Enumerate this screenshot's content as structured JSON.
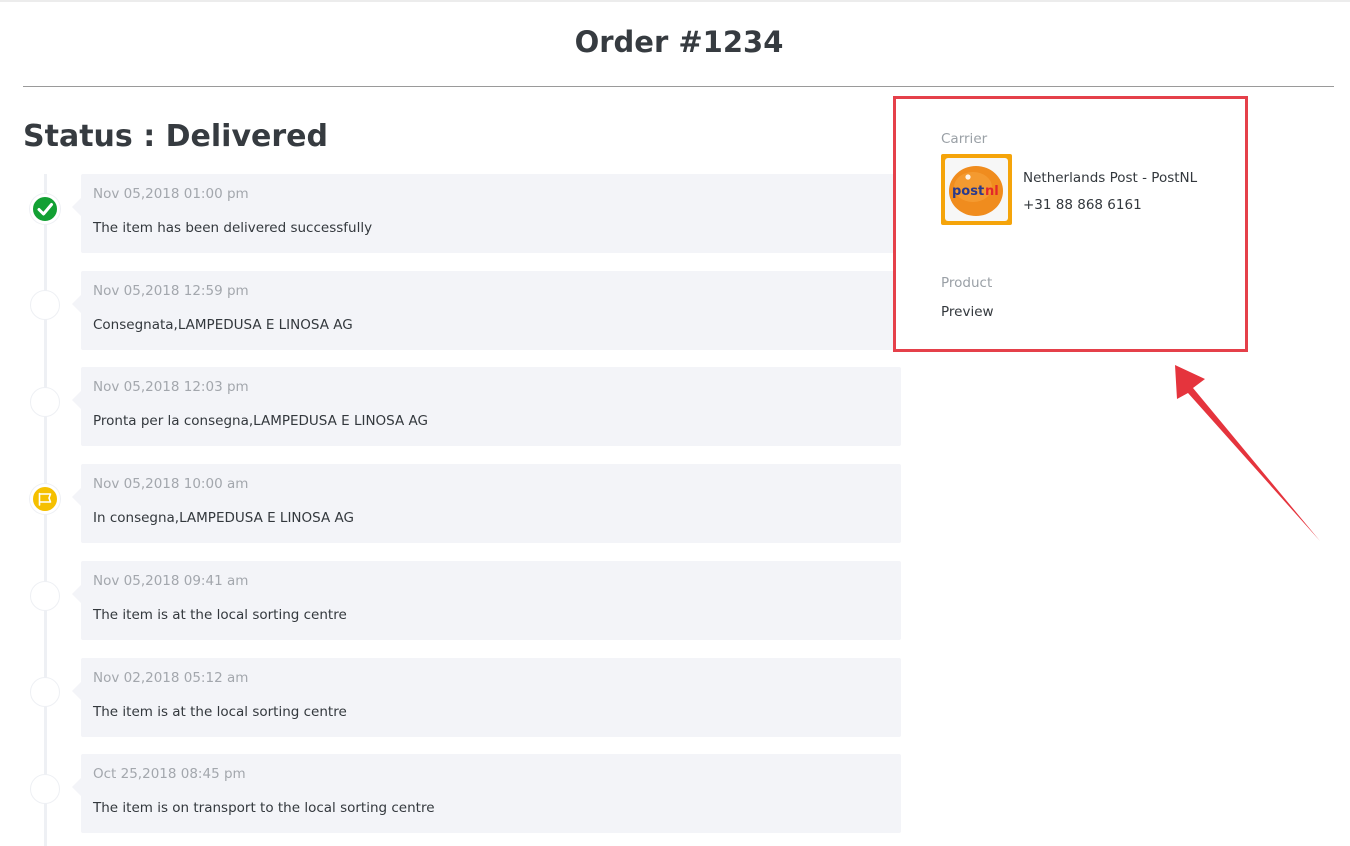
{
  "page": {
    "title": "Order #1234"
  },
  "status": {
    "heading": "Status : Delivered"
  },
  "events": [
    {
      "time": "Nov 05,2018 01:00 pm",
      "description": "The item has been delivered successfully",
      "marker": "checkmark-icon"
    },
    {
      "time": "Nov 05,2018 12:59 pm",
      "description": "Consegnata,LAMPEDUSA E LINOSA AG",
      "marker": "empty"
    },
    {
      "time": "Nov 05,2018 12:03 pm",
      "description": "Pronta per la consegna,LAMPEDUSA E LINOSA AG",
      "marker": "empty"
    },
    {
      "time": "Nov 05,2018 10:00 am",
      "description": "In consegna,LAMPEDUSA E LINOSA AG",
      "marker": "flag-icon"
    },
    {
      "time": "Nov 05,2018 09:41 am",
      "description": "The item is at the local sorting centre",
      "marker": "empty"
    },
    {
      "time": "Nov 02,2018 05:12 am",
      "description": "The item is at the local sorting centre",
      "marker": "empty"
    },
    {
      "time": "Oct 25,2018 08:45 pm",
      "description": "The item is on transport to the local sorting centre",
      "marker": "empty"
    }
  ],
  "carrier": {
    "label": "Carrier",
    "name": "Netherlands Post - PostNL",
    "phone": "+31 88 868 6161",
    "logo_text": "postnl",
    "logo_color": "#f5a40a"
  },
  "product": {
    "label": "Product",
    "value": "Preview"
  },
  "colors": {
    "delivered": "#12a033",
    "out_for_delivery": "#f5c000",
    "highlight": "#e5404a"
  }
}
